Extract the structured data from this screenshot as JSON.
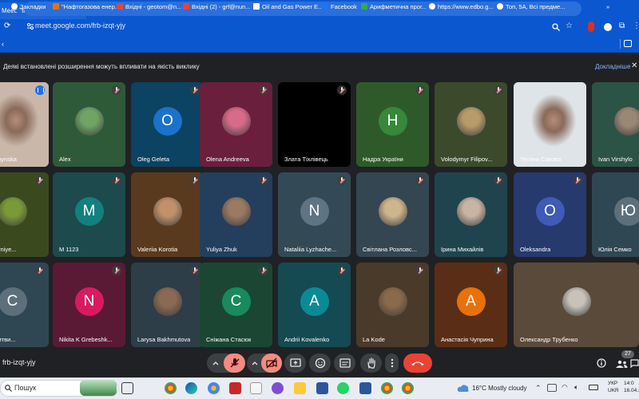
{
  "browser": {
    "tab_title": "Meet: \"frb-izqt-yjy\"",
    "tab_close": "✕",
    "new_tab": "+",
    "url": "meet.google.com/frb-izqt-yjy",
    "bookmarks": [
      {
        "label": "Закладки",
        "icon": "star-icon",
        "color": "#ffffff"
      },
      {
        "label": "\"Нафтогазова енер...",
        "icon": "bookmark-favicon",
        "color": "#e37400"
      },
      {
        "label": "Вхідні - geotom@n...",
        "icon": "gmail-icon",
        "color": "#ea4335"
      },
      {
        "label": "Вхідні (2) - grf@nun...",
        "icon": "gmail-icon",
        "color": "#ea4335"
      },
      {
        "label": "Oil and Gas Power E...",
        "icon": "site-favicon",
        "color": "#ffffff"
      },
      {
        "label": "Facebook",
        "icon": "facebook-icon",
        "color": "#1877f2"
      },
      {
        "label": "Арифметична прог...",
        "icon": "site-favicon",
        "color": "#34a853"
      },
      {
        "label": "https://www.edbo.g...",
        "icon": "globe-icon",
        "color": "#ffffff"
      },
      {
        "label": "Топ, 5А, Всі предме...",
        "icon": "globe-icon",
        "color": "#ffffff"
      }
    ],
    "bookmarks_more": "»"
  },
  "infobar": {
    "message": "Деякі встановлені розширення можуть впливати на якість виклику",
    "details_link": "Докладніше",
    "close": "✕"
  },
  "participants": [
    {
      "name": "a Buchynska",
      "kind": "video",
      "status": "speaking",
      "bg": "#c9b7a9"
    },
    {
      "name": "Alex",
      "kind": "photo",
      "status": "muted",
      "bg": "#2e5a3a",
      "avatar_color": "#6fa463"
    },
    {
      "name": "Oleg Geleta",
      "kind": "letter",
      "letter": "O",
      "status": "muted",
      "bg": "#0c4262",
      "avatar_color": "#1a73c8"
    },
    {
      "name": "Olena Andreeva",
      "kind": "photo",
      "status": "muted",
      "bg": "#6a1f3c",
      "avatar_color": "#d86b8a"
    },
    {
      "name": "Злата Тіхлівець",
      "kind": "video",
      "status": "muted",
      "bg": "#000000"
    },
    {
      "name": "Надра України",
      "kind": "letter",
      "letter": "Н",
      "status": "muted",
      "bg": "#2e5a2a",
      "avatar_color": "#37883a"
    },
    {
      "name": "Volodymyr Filipov...",
      "kind": "photo",
      "status": "muted",
      "bg": "#3c4a2c",
      "avatar_color": "#b89b6a"
    },
    {
      "name": "Тетяна Сакова",
      "kind": "video",
      "status": "none",
      "bg": "#dfe4e8"
    },
    {
      "name": "Ivan Virshylo",
      "kind": "photo",
      "status": "muted",
      "bg": "#2b5346",
      "avatar_color": "#9a8874"
    },
    {
      "name": "a Cherniye...",
      "kind": "photo",
      "status": "muted",
      "bg": "#3a4a1e",
      "avatar_color": "#7a9a3a"
    },
    {
      "name": "M 1123",
      "kind": "letter",
      "letter": "M",
      "status": "muted",
      "bg": "#1d4a4c",
      "avatar_color": "#12807e"
    },
    {
      "name": "Valeriia Korotia",
      "kind": "photo",
      "status": "muted",
      "bg": "#5a3a1e",
      "avatar_color": "#c0916a"
    },
    {
      "name": "Yuliya Zhuk",
      "kind": "photo",
      "status": "muted",
      "bg": "#243e5e",
      "avatar_color": "#9a7a62"
    },
    {
      "name": "Nataliia Lyzhache...",
      "kind": "letter",
      "letter": "N",
      "status": "muted",
      "bg": "#334a56",
      "avatar_color": "#5f7482"
    },
    {
      "name": "Світлана Розловс...",
      "kind": "photo",
      "status": "muted",
      "bg": "#344652",
      "avatar_color": "#cdb58d"
    },
    {
      "name": "Ірина Михайлів",
      "kind": "photo",
      "status": "muted",
      "bg": "#20444e",
      "avatar_color": "#c7b4a5"
    },
    {
      "name": "Oleksandra",
      "kind": "letter",
      "letter": "O",
      "status": "muted",
      "bg": "#263a6e",
      "avatar_color": "#3f5bb5"
    },
    {
      "name": "Юлія Семко",
      "kind": "letter",
      "letter": "Ю",
      "status": "muted",
      "bg": "#2f4752",
      "avatar_color": "#5d6f7a"
    },
    {
      "name": "лав Литви...",
      "kind": "letter",
      "letter": "С",
      "status": "muted",
      "bg": "#2f4752",
      "avatar_color": "#5d6f7a"
    },
    {
      "name": "Nikita K Grebeshk...",
      "kind": "letter",
      "letter": "N",
      "status": "muted",
      "bg": "#5a1a36",
      "avatar_color": "#d81b60"
    },
    {
      "name": "Larysa Bakhmutova",
      "kind": "photo",
      "status": "muted",
      "bg": "#2e3e48",
      "avatar_color": "#8a6a55"
    },
    {
      "name": "Сніжана Стасюк",
      "kind": "letter",
      "letter": "С",
      "status": "muted",
      "bg": "#1b4634",
      "avatar_color": "#188a5c"
    },
    {
      "name": "Andrii Kovalenko",
      "kind": "letter",
      "letter": "A",
      "status": "muted",
      "bg": "#154a52",
      "avatar_color": "#0b8a96"
    },
    {
      "name": "La Kode",
      "kind": "photo",
      "status": "muted",
      "bg": "#4a3a2a",
      "avatar_color": "#8a6a4a"
    },
    {
      "name": "Анастасія Чуприна",
      "kind": "letter",
      "letter": "A",
      "status": "muted",
      "bg": "#5a2e16",
      "avatar_color": "#e8710a"
    },
    {
      "name": "Олександр Трубенко",
      "kind": "photo",
      "status": "none",
      "bg": "#5a4a3a",
      "avatar_color": "#c9c2ba"
    }
  ],
  "controls": {
    "meeting_code": "frb-izqt-yjy",
    "participants_count": "27",
    "buttons": [
      "mic-chevron",
      "mic-off",
      "camera-chevron",
      "camera-off",
      "present",
      "emoji",
      "captions",
      "raise-hand",
      "more",
      "hang-up",
      "info",
      "people"
    ]
  },
  "taskbar": {
    "search_placeholder": "Пошук",
    "weather": "16°C  Mostly cloudy",
    "lang_line1": "УКР",
    "lang_line2": "UKR",
    "time": "14:0",
    "date": "16.04.2"
  },
  "colors": {
    "accent": "#0b57d0",
    "meet_bg": "#202124",
    "hangup": "#ea4335",
    "muted_ctrl": "#f28b82"
  }
}
